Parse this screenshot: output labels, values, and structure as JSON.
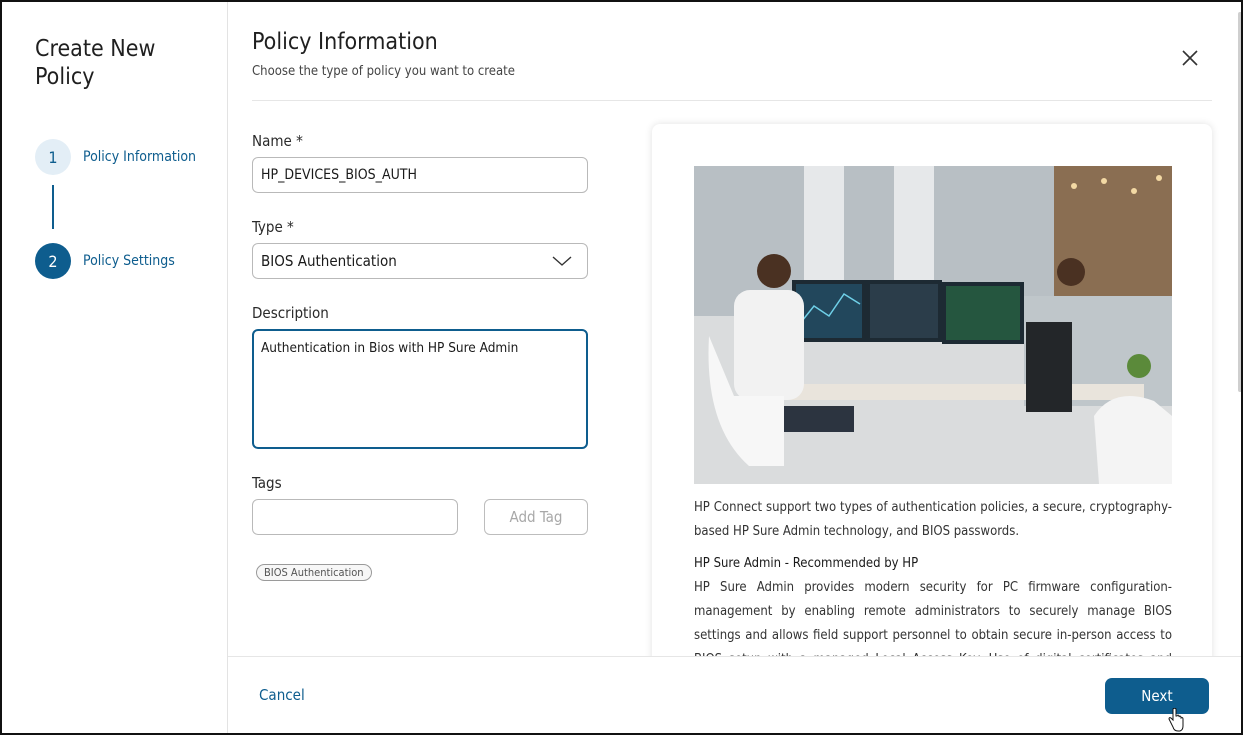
{
  "sidebar": {
    "title": "Create New\nPolicy",
    "steps": [
      {
        "number": "1",
        "label": "Policy Information"
      },
      {
        "number": "2",
        "label": "Policy Settings"
      }
    ]
  },
  "header": {
    "title": "Policy Information",
    "subtitle": "Choose the type of policy you want to create"
  },
  "form": {
    "name_label": "Name *",
    "name_value": "HP_DEVICES_BIOS_AUTH",
    "type_label": "Type *",
    "type_value": "BIOS Authentication",
    "description_label": "Description",
    "description_value": "Authentication in Bios with HP Sure Admin",
    "tags_label": "Tags",
    "tags_value": "",
    "add_tag_label": "Add Tag",
    "tags": [
      "BIOS Authentication"
    ]
  },
  "info": {
    "intro": "HP Connect support two types of authentication policies, a secure, cryptography-based HP Sure Admin technology, and BIOS passwords.",
    "heading": "HP Sure Admin - Recommended by HP",
    "body": "HP Sure Admin provides modern security for PC firmware configuration-management by enabling remote administrators to securely manage BIOS settings and allows field support personnel to obtain secure in-person access to BIOS setup with a managed Local Access Key. Use of digital certificates and public key cryptography eliminates"
  },
  "footer": {
    "cancel_label": "Cancel",
    "next_label": "Next"
  },
  "colors": {
    "accent": "#0e5d8e",
    "step_inactive_bg": "#e3eef6"
  },
  "icons": {
    "close": "close-icon",
    "dropdown": "chevron-down-icon",
    "cursor": "hand-pointer-icon"
  }
}
